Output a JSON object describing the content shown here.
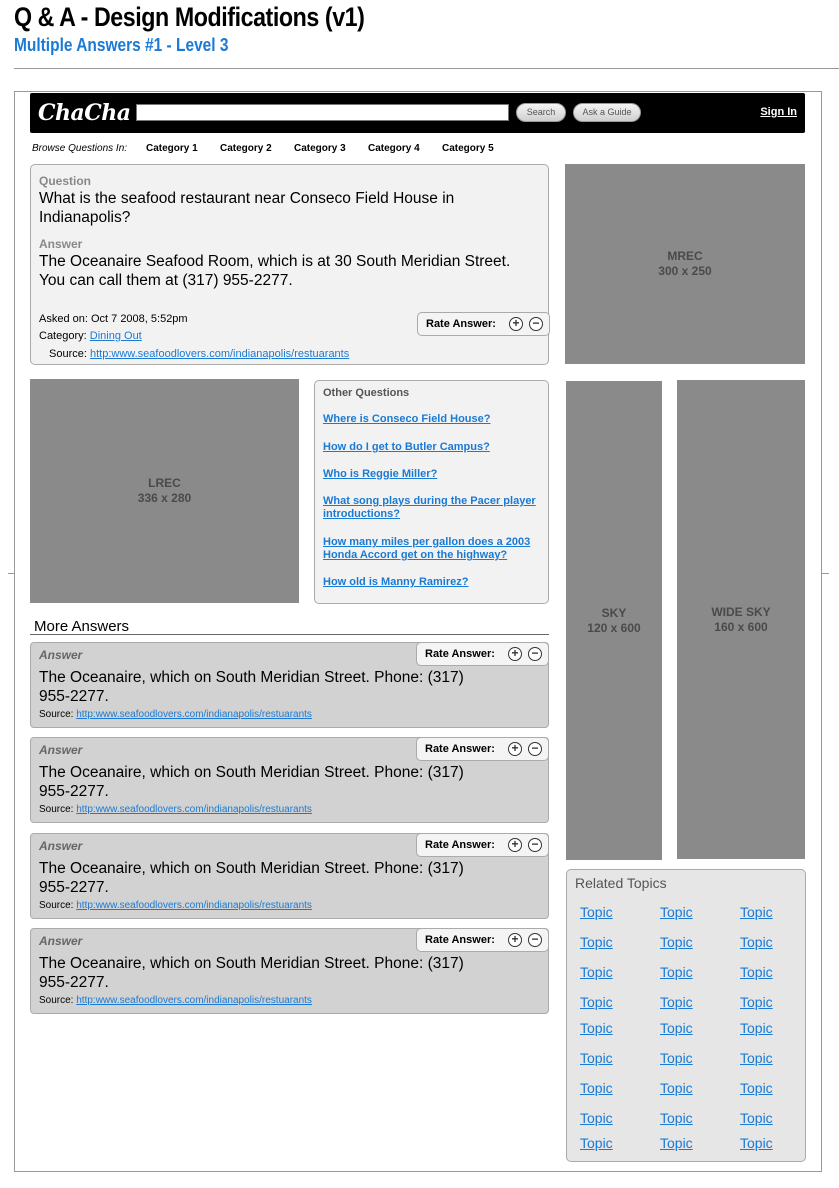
{
  "document": {
    "title": "Q & A - Design Modifications (v1)",
    "subtitle": "Multiple Answers #1 - Level 3"
  },
  "header": {
    "logo": "ChaCha",
    "search_value": "",
    "search_button": "Search",
    "guide_button": "Ask a Guide",
    "sign_in": "Sign In"
  },
  "browse": {
    "label": "Browse Questions In:",
    "categories": [
      "Category 1",
      "Category 2",
      "Category 3",
      "Category 4",
      "Category 5"
    ]
  },
  "main_qa": {
    "question_label": "Question",
    "question": "What is the seafood restaurant near Conseco Field House in Indianapolis?",
    "answer_label": "Answer",
    "answer": "The Oceanaire Seafood Room, which is at 30 South Meridian Street. You can call them at (317) 955-2277.",
    "asked_on": "Asked on: Oct 7 2008, 5:52pm",
    "category_label": "Category:",
    "category_value": "Dining Out",
    "source_label": "Source:",
    "source_url": "http:www.seafoodlovers.com/indianapolis/restuarants",
    "rate_label": "Rate Answer:"
  },
  "ads": {
    "mrec": {
      "name": "MREC",
      "size": "300 x 250"
    },
    "lrec": {
      "name": "LREC",
      "size": "336 x 280"
    },
    "sky": {
      "name": "SKY",
      "size": "120 x 600"
    },
    "wide_sky": {
      "name": "WIDE SKY",
      "size": "160 x 600"
    }
  },
  "other_questions": {
    "title": "Other Questions",
    "items": [
      "Where is Conseco Field House?",
      "How do I get to Butler Campus?",
      "Who is Reggie Miller?",
      "What song plays during the Pacer player introductions?",
      "How many miles per gallon does a 2003 Honda Accord get on the highway?",
      "How old is Manny Ramirez?"
    ]
  },
  "more_answers": {
    "title": "More Answers",
    "items": [
      {
        "label": "Answer",
        "text": "The Oceanaire, which on South Meridian Street. Phone: (317) 955-2277.",
        "source_label": "Source:",
        "source_url": "http:www.seafoodlovers.com/indianapolis/restuarants",
        "rate_label": "Rate Answer:"
      },
      {
        "label": "Answer",
        "text": "The Oceanaire, which on South Meridian Street. Phone: (317) 955-2277.",
        "source_label": "Source:",
        "source_url": "http:www.seafoodlovers.com/indianapolis/restuarants",
        "rate_label": "Rate Answer:"
      },
      {
        "label": "Answer",
        "text": "The Oceanaire, which on South Meridian Street. Phone: (317) 955-2277.",
        "source_label": "Source:",
        "source_url": "http:www.seafoodlovers.com/indianapolis/restuarants",
        "rate_label": "Rate Answer:"
      },
      {
        "label": "Answer",
        "text": "The Oceanaire, which on South Meridian Street. Phone: (317) 955-2277.",
        "source_label": "Source:",
        "source_url": "http:www.seafoodlovers.com/indianapolis/restuarants",
        "rate_label": "Rate Answer:"
      }
    ]
  },
  "related_topics": {
    "title": "Related Topics",
    "topics": [
      "Topic",
      "Topic",
      "Topic",
      "Topic",
      "Topic",
      "Topic",
      "Topic",
      "Topic",
      "Topic",
      "Topic",
      "Topic",
      "Topic",
      "Topic",
      "Topic",
      "Topic",
      "Topic",
      "Topic",
      "Topic",
      "Topic",
      "Topic",
      "Topic",
      "Topic",
      "Topic",
      "Topic",
      "Topic",
      "Topic",
      "Topic"
    ]
  },
  "icons": {
    "plus": "plus-circle-icon",
    "minus": "minus-circle-icon"
  },
  "colors": {
    "link": "#1a7ad4",
    "subtitle": "#1a7ad4",
    "ad_gray": "#8a8a8a"
  }
}
